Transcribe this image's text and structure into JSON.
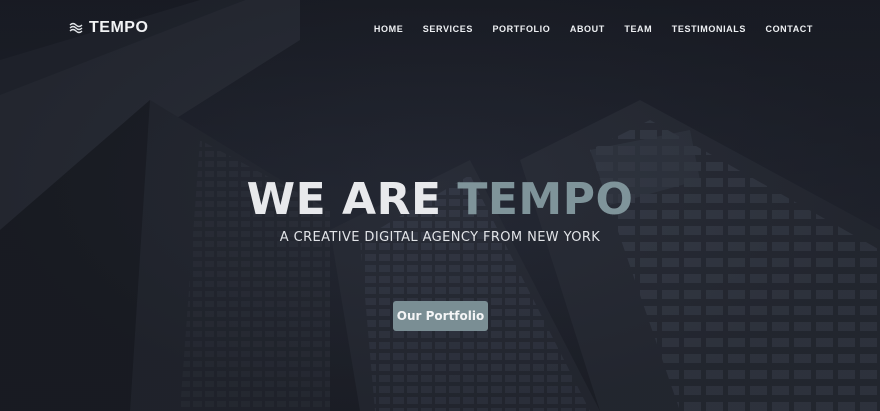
{
  "brand": {
    "name": "TEMPO",
    "icon": "waves-logo-icon"
  },
  "nav": {
    "items": [
      {
        "label": "HOME"
      },
      {
        "label": "SERVICES"
      },
      {
        "label": "PORTFOLIO"
      },
      {
        "label": "ABOUT"
      },
      {
        "label": "TEAM"
      },
      {
        "label": "TESTIMONIALS"
      },
      {
        "label": "CONTACT"
      }
    ]
  },
  "hero": {
    "title_prefix": "WE ARE",
    "title_accent": "TEMPO",
    "subtitle": "A CREATIVE DIGITAL AGENCY FROM NEW YORK",
    "cta_label": "Our Portfolio"
  },
  "colors": {
    "background": "#1c1f28",
    "accent": "#7f949a",
    "button": "#7a8e94",
    "text": "#e8e9ec"
  }
}
